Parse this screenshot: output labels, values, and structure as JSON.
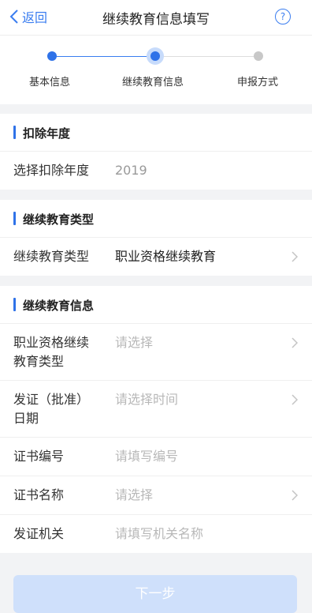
{
  "nav": {
    "back_label": "返回",
    "title": "继续教育信息填写",
    "help": "?"
  },
  "steps": [
    {
      "label": "基本信息",
      "state": "done"
    },
    {
      "label": "继续教育信息",
      "state": "current"
    },
    {
      "label": "申报方式",
      "state": "pending"
    }
  ],
  "deduction_year": {
    "heading": "扣除年度",
    "row_label": "选择扣除年度",
    "row_value": "2019"
  },
  "education_type": {
    "heading": "继续教育类型",
    "row_label": "继续教育类型",
    "row_value": "职业资格继续教育"
  },
  "education_info": {
    "heading": "继续教育信息",
    "rows": [
      {
        "label_line1": "职业资格继续",
        "label_line2": "教育类型",
        "placeholder": "请选择"
      },
      {
        "label_line1": "发证（批准）",
        "label_line2": "日期",
        "placeholder": "请选择时间"
      },
      {
        "label": "证书编号",
        "placeholder": "请填写编号"
      },
      {
        "label": "证书名称",
        "placeholder": "请选择"
      },
      {
        "label": "发证机关",
        "placeholder": "请填写机关名称"
      }
    ]
  },
  "next_button": "下一步",
  "colors": {
    "accent": "#2f72e8",
    "button_disabled": "#cfe0fb"
  }
}
